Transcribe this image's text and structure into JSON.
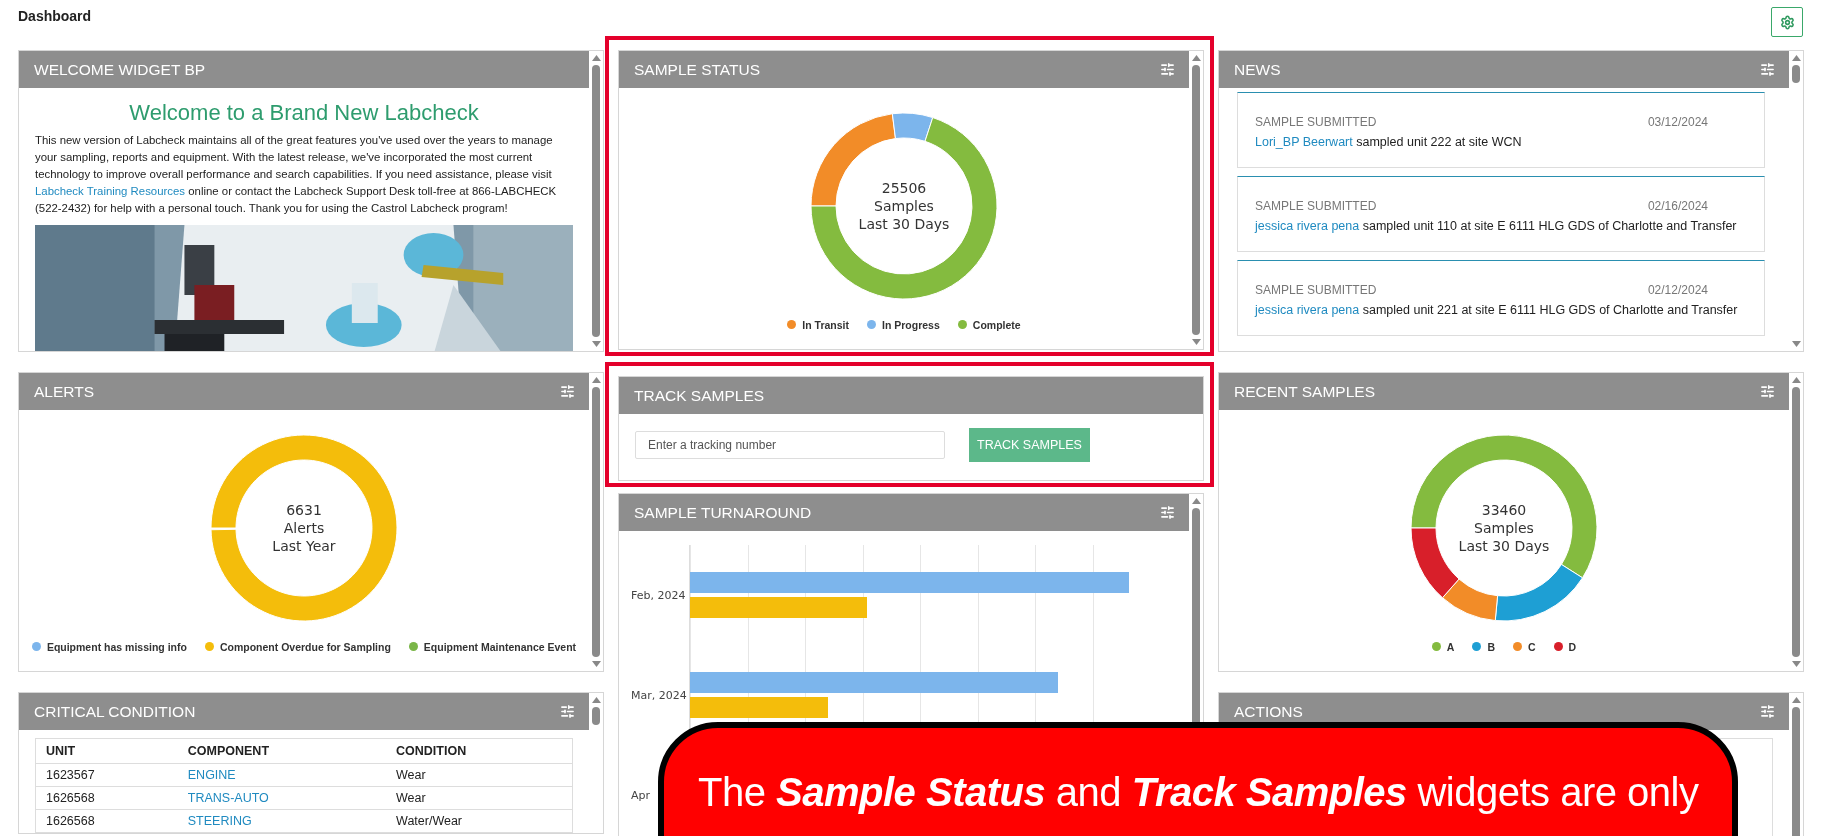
{
  "page": {
    "title": "Dashboard"
  },
  "columns": [
    [
      {
        "kind": "welcome",
        "title": "WELCOME WIDGET BP",
        "settings": false,
        "highlighted": false,
        "heading": "Welcome to a Brand New Labcheck",
        "text_before": "This new version of Labcheck maintains all of the great features you've used over the years to manage your sampling, reports and equipment. With the latest release, we've incorporated the most current technology to improve overall performance and search capabilities. If you need assistance, please visit",
        "link": "Labcheck Training Resources",
        "text_after": "online or contact the Labcheck Support Desk toll-free at 866-LABCHECK (522-2432) for help with a personal touch. Thank you for using the Castrol Labcheck program!"
      },
      {
        "kind": "donut",
        "title": "ALERTS",
        "settings": true,
        "highlighted": false,
        "total": "6631",
        "unit": "Alerts",
        "period": "Last Year",
        "legend": [
          {
            "label": "Equipment has missing info",
            "color": "#7cb5ec"
          },
          {
            "label": "Component Overdue for Sampling",
            "color": "#f4bd0b"
          },
          {
            "label": "Equipment Maintenance Event",
            "color": "#7ab648"
          }
        ]
      },
      {
        "kind": "table",
        "title": "CRITICAL CONDITION",
        "settings": true,
        "highlighted": false,
        "columns": [
          "UNIT",
          "COMPONENT",
          "CONDITION"
        ],
        "rows": [
          [
            "1623567",
            "ENGINE",
            "Wear"
          ],
          [
            "1626568",
            "TRANS-AUTO",
            "Wear"
          ],
          [
            "1626568",
            "STEERING",
            "Water/Wear"
          ]
        ]
      }
    ],
    [
      {
        "kind": "donut",
        "title": "SAMPLE STATUS",
        "settings": true,
        "highlighted": true,
        "total": "25506",
        "unit": "Samples",
        "period": "Last 30 Days",
        "legend": [
          {
            "label": "In Transit",
            "color": "#f28c28"
          },
          {
            "label": "In Progress",
            "color": "#7cb5ec"
          },
          {
            "label": "Complete",
            "color": "#84bb3f"
          }
        ]
      },
      {
        "kind": "track",
        "title": "TRACK SAMPLES",
        "settings": false,
        "highlighted": true,
        "placeholder": "Enter a tracking number",
        "button": "TRACK SAMPLES"
      },
      {
        "kind": "bars",
        "title": "SAMPLE TURNAROUND",
        "settings": true,
        "highlighted": false,
        "groups": [
          {
            "label": "Feb, 2024",
            "bars": [
              {
                "color": "#7cb5ec",
                "level": 0.955
              },
              {
                "color": "#f4bd0b",
                "level": 0.385
              }
            ]
          },
          {
            "label": "Mar, 2024",
            "bars": [
              {
                "color": "#7cb5ec",
                "level": 0.8
              },
              {
                "color": "#f4bd0b",
                "level": 0.3
              }
            ]
          },
          {
            "label": "Apr"
          }
        ]
      }
    ],
    [
      {
        "kind": "news",
        "title": "NEWS",
        "settings": true,
        "highlighted": false,
        "items": [
          {
            "category": "SAMPLE SUBMITTED",
            "date": "03/12/2024",
            "user": "Lori_BP Beerwart",
            "text": "sampled unit 222 at site WCN"
          },
          {
            "category": "SAMPLE SUBMITTED",
            "date": "02/16/2024",
            "user": "jessica rivera pena",
            "text": "sampled unit 110 at site E 6111 HLG GDS of Charlotte and Transfer"
          },
          {
            "category": "SAMPLE SUBMITTED",
            "date": "02/12/2024",
            "user": "jessica rivera pena",
            "text": "sampled unit 221 at site E 6111 HLG GDS of Charlotte and Transfer"
          }
        ]
      },
      {
        "kind": "donut",
        "title": "RECENT SAMPLES",
        "settings": true,
        "highlighted": false,
        "total": "33460",
        "unit": "Samples",
        "period": "Last 30 Days",
        "legend": [
          {
            "label": "A",
            "color": "#84bb3f"
          },
          {
            "label": "B",
            "color": "#1e9fd4"
          },
          {
            "label": "C",
            "color": "#f28c28"
          },
          {
            "label": "D",
            "color": "#d81f2a"
          }
        ]
      },
      {
        "kind": "actions",
        "title": "ACTIONS",
        "settings": true,
        "highlighted": false
      }
    ]
  ],
  "callout": {
    "text": "The **Sample Status** and **Track Samples** widgets are only"
  }
}
